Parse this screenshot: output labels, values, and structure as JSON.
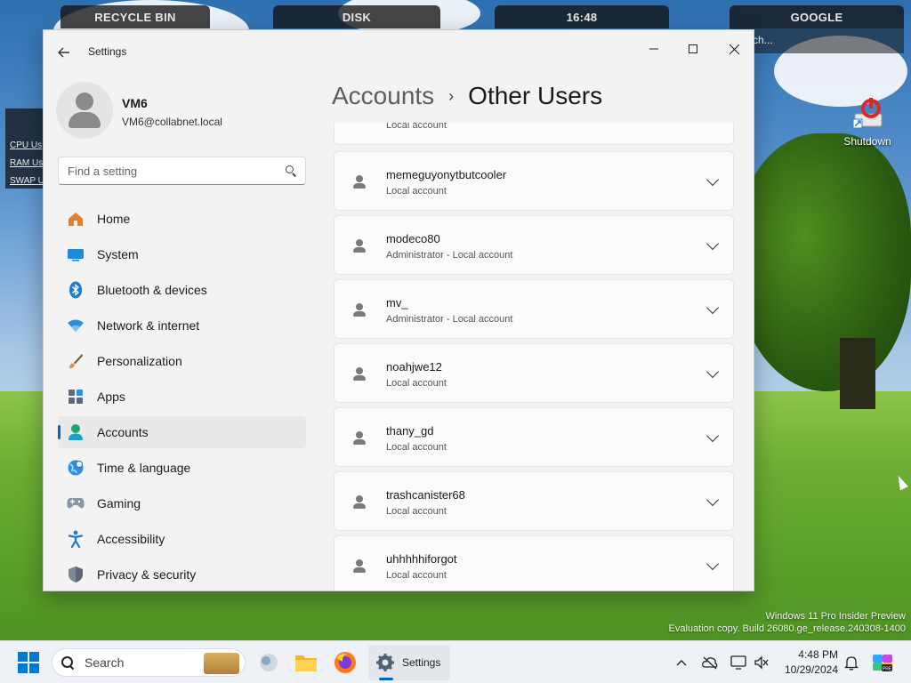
{
  "desktop": {
    "widgets": {
      "recycle_bin": "RECYCLE BIN",
      "disk": "DISK",
      "time": "16:48",
      "google": "GOOGLE",
      "google_search_hint": "ch..."
    },
    "system_monitor": {
      "cpu": "CPU Us",
      "ram": "RAM Us",
      "swap": "SWAP U"
    },
    "shortcut_label": "Shutdown",
    "watermark": {
      "line1": "Windows 11 Pro Insider Preview",
      "line2": "Evaluation copy. Build 26080.ge_release.240308-1400"
    }
  },
  "window": {
    "app_title": "Settings",
    "controls": {
      "minimize": "—",
      "maximize": "☐",
      "close": "✕"
    }
  },
  "profile": {
    "name": "VM6",
    "email": "VM6@collabnet.local"
  },
  "search": {
    "placeholder": "Find a setting"
  },
  "nav": {
    "items": [
      {
        "label": "Home",
        "icon": "home-icon"
      },
      {
        "label": "System",
        "icon": "system-icon"
      },
      {
        "label": "Bluetooth & devices",
        "icon": "bluetooth-icon"
      },
      {
        "label": "Network & internet",
        "icon": "wifi-icon"
      },
      {
        "label": "Personalization",
        "icon": "brush-icon"
      },
      {
        "label": "Apps",
        "icon": "apps-icon"
      },
      {
        "label": "Accounts",
        "icon": "accounts-icon",
        "active": true
      },
      {
        "label": "Time & language",
        "icon": "globe-icon"
      },
      {
        "label": "Gaming",
        "icon": "gamepad-icon"
      },
      {
        "label": "Accessibility",
        "icon": "accessibility-icon"
      },
      {
        "label": "Privacy & security",
        "icon": "shield-icon"
      }
    ]
  },
  "breadcrumb": {
    "parent": "Accounts",
    "separator": "›",
    "current": "Other Users"
  },
  "users": [
    {
      "name": "",
      "type": "Local account"
    },
    {
      "name": "memeguyonytbutcooler",
      "type": "Local account"
    },
    {
      "name": "modeco80",
      "type": "Administrator - Local account"
    },
    {
      "name": "mv_",
      "type": "Administrator - Local account"
    },
    {
      "name": "noahjwe12",
      "type": "Local account"
    },
    {
      "name": "thany_gd",
      "type": "Local account"
    },
    {
      "name": "trashcanister68",
      "type": "Local account"
    },
    {
      "name": "uhhhhhiforgot",
      "type": "Local account"
    }
  ],
  "taskbar": {
    "search_label": "Search",
    "active_app_label": "Settings",
    "clock_time": "4:48 PM",
    "clock_date": "10/29/2024"
  },
  "colors": {
    "accent": "#0067c0",
    "window_bg": "#f3f3f3",
    "card_bg": "#fbfbfb",
    "shutdown_red": "#d9282a"
  }
}
